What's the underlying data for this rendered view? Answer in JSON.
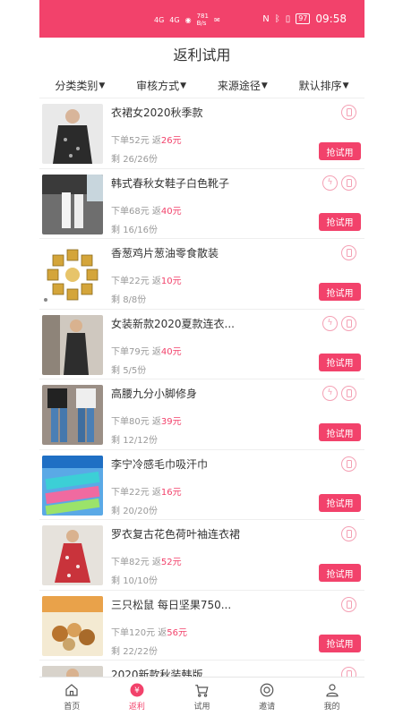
{
  "status_bar": {
    "signal_1": "4G",
    "signal_2": "4G",
    "speed_value": "781",
    "speed_unit": "B/s",
    "battery": "97",
    "time": "09:58"
  },
  "title": "返利试用",
  "filters": [
    {
      "label": "分类类别"
    },
    {
      "label": "审核方式"
    },
    {
      "label": "来源途径"
    },
    {
      "label": "默认排序"
    }
  ],
  "labels": {
    "order_prefix": "下单",
    "rebate_prefix": "返",
    "remain_prefix": "剩",
    "button": "抢试用"
  },
  "products": [
    {
      "name": "衣裙女2020秋季款",
      "price": "52元",
      "rebate": "26元",
      "remain": "26/26份",
      "flash": false
    },
    {
      "name": "韩式春秋女鞋子白色靴子",
      "price": "68元",
      "rebate": "40元",
      "remain": "16/16份",
      "flash": true
    },
    {
      "name": "香葱鸡片葱油零食散装",
      "price": "22元",
      "rebate": "10元",
      "remain": "8/8份",
      "flash": false
    },
    {
      "name": "女装新款2020夏款连衣...",
      "price": "79元",
      "rebate": "40元",
      "remain": "5/5份",
      "flash": true
    },
    {
      "name": "高腰九分小脚修身",
      "price": "80元",
      "rebate": "39元",
      "remain": "12/12份",
      "flash": true
    },
    {
      "name": "李宁冷感毛巾吸汗巾",
      "price": "22元",
      "rebate": "16元",
      "remain": "20/20份",
      "flash": false
    },
    {
      "name": "罗衣复古花色荷叶袖连衣裙",
      "price": "82元",
      "rebate": "52元",
      "remain": "10/10份",
      "flash": false
    },
    {
      "name": "三只松鼠 每日坚果750...",
      "price": "120元",
      "rebate": "56元",
      "remain": "22/22份",
      "flash": false
    },
    {
      "name": "2020新款秋装韩版",
      "price": "",
      "rebate": "",
      "remain": "",
      "flash": false
    }
  ],
  "tabs": [
    {
      "label": "首页",
      "icon": "home-icon",
      "active": false
    },
    {
      "label": "返利",
      "icon": "rebate-icon",
      "active": true
    },
    {
      "label": "试用",
      "icon": "cart-icon",
      "active": false
    },
    {
      "label": "邀请",
      "icon": "invite-icon",
      "active": false
    },
    {
      "label": "我的",
      "icon": "profile-icon",
      "active": false
    }
  ],
  "colors": {
    "accent": "#f2426b",
    "icon_outline": "#f4a0b4"
  }
}
